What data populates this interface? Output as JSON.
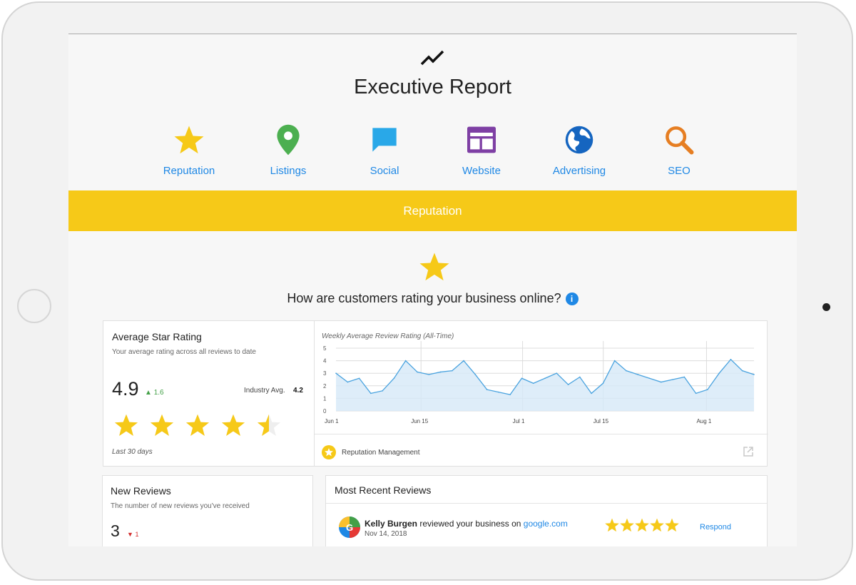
{
  "header": {
    "logo_icon": "trending-line-icon",
    "title": "Executive Report",
    "nav": [
      {
        "label": "Reputation",
        "icon": "star-icon",
        "color": "#f6c918"
      },
      {
        "label": "Listings",
        "icon": "map-pin-icon",
        "color": "#4caf50"
      },
      {
        "label": "Social",
        "icon": "chat-bubble-icon",
        "color": "#29a8e8"
      },
      {
        "label": "Website",
        "icon": "webpage-icon",
        "color": "#7e3fa4"
      },
      {
        "label": "Advertising",
        "icon": "globe-icon",
        "color": "#1565c0"
      },
      {
        "label": "SEO",
        "icon": "magnifier-icon",
        "color": "#e67e22"
      }
    ]
  },
  "banner": {
    "label": "Reputation",
    "color": "#f6c918"
  },
  "section": {
    "question": "How are customers rating your business online?",
    "info_icon": "info-icon"
  },
  "avg_rating": {
    "title": "Average Star Rating",
    "subtitle": "Your average rating across all reviews to date",
    "value": "4.9",
    "delta": "1.6",
    "delta_direction": "up",
    "industry_label": "Industry Avg.",
    "industry_value": "4.2",
    "stars": 4.5,
    "period": "Last 30 days"
  },
  "chart": {
    "footer_label": "Reputation Management",
    "footer_icon": "star-badge-icon",
    "external_icon": "external-link-icon",
    "chart_data": {
      "type": "area",
      "title": "Weekly Average Review Rating (All-Time)",
      "xlabel": "",
      "ylabel": "",
      "ylim": [
        0,
        5
      ],
      "yticks": [
        "0",
        "1",
        "2",
        "3",
        "4",
        "5"
      ],
      "xticks": [
        "Jun 1",
        "Jun 15",
        "Jul 1",
        "Jul 15",
        "Aug 1"
      ],
      "grid": true,
      "series": [
        {
          "values": [
            3.0,
            2.3,
            2.6,
            1.4,
            1.6,
            2.6,
            4.0,
            3.1,
            2.9,
            3.1,
            3.2,
            4.0,
            2.9,
            1.7,
            1.5,
            1.3,
            2.6,
            2.2,
            2.6,
            3.0,
            2.1,
            2.7,
            1.4,
            2.2,
            4.0,
            3.2,
            2.9,
            2.6,
            2.3,
            2.5,
            2.7,
            1.4,
            1.7,
            3.0,
            4.1,
            3.2,
            2.9
          ]
        }
      ],
      "color": "#4aa3df"
    }
  },
  "new_reviews": {
    "title": "New Reviews",
    "subtitle": "The number of new reviews you've received",
    "value": "3",
    "delta": "1",
    "delta_direction": "down"
  },
  "recent_reviews": {
    "title": "Most Recent Reviews",
    "items": [
      {
        "reviewer": "Kelly Burgen",
        "text": "reviewed your business on",
        "source": "google.com",
        "date": "Nov 14, 2018",
        "stars": 5,
        "action": "Respond",
        "icon": "google-maps-icon"
      }
    ]
  },
  "colors": {
    "accent": "#1f88e5",
    "star": "#f6c918",
    "up": "#43a047",
    "down": "#d32f2f"
  }
}
